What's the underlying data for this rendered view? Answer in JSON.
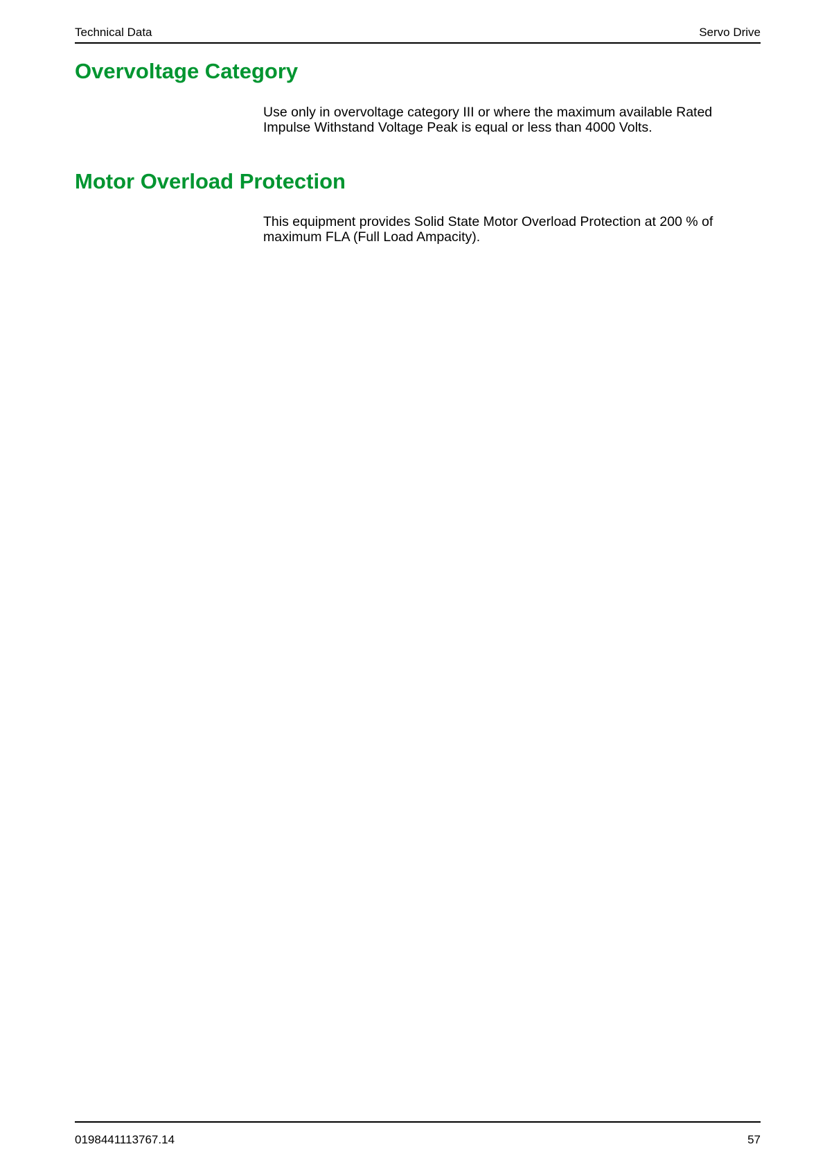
{
  "header": {
    "left": "Technical Data",
    "right": "Servo Drive"
  },
  "sections": [
    {
      "title": "Overvoltage Category",
      "body": "Use only in overvoltage category III or where the maximum available Rated Impulse Withstand Voltage Peak is equal or less than 4000 Volts."
    },
    {
      "title": "Motor Overload Protection",
      "body": "This equipment provides Solid State Motor Overload Protection at 200 % of maximum FLA (Full Load Ampacity)."
    }
  ],
  "footer": {
    "doc_number": "0198441113767.14",
    "page_number": "57"
  },
  "colors": {
    "heading": "#009530",
    "text": "#000000"
  }
}
